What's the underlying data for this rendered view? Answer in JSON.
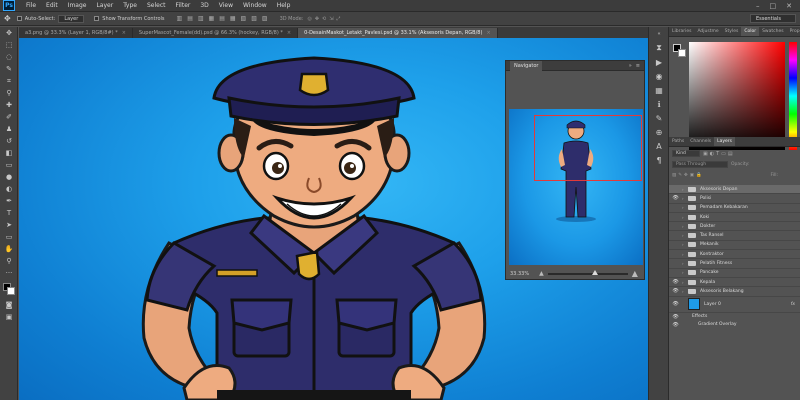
{
  "app": {
    "logo": "Ps"
  },
  "menu": [
    "File",
    "Edit",
    "Image",
    "Layer",
    "Type",
    "Select",
    "Filter",
    "3D",
    "View",
    "Window",
    "Help"
  ],
  "window_controls": [
    "–",
    "□",
    "✕"
  ],
  "options": {
    "auto_select_label": "Auto-Select:",
    "auto_select_value": "Layer",
    "transform_label": "Show Transform Controls",
    "mode_label": "3D Mode:",
    "workspace": "Essentials"
  },
  "tabs": [
    {
      "label": "a3.png @ 33.3% (Layer 1, RGB/8#) *",
      "close": "×"
    },
    {
      "label": "SuperMascot_Female(dd).psd @ 66.3% (hockey, RGB/8) *",
      "close": "×"
    },
    {
      "label": "0-DesainMaskot_Letakt_Pavlesi.psd @ 33.1% (Aksesoris Depan, RGB/8)",
      "close": "×"
    }
  ],
  "navigator": {
    "title": "Navigator",
    "zoom": "33.33%"
  },
  "color_panel": {
    "tabs": [
      "Libraries",
      "Adjustme",
      "Styles",
      "Color",
      "Swatches",
      "Properties"
    ],
    "active": "Color"
  },
  "layers_panel": {
    "tabs": [
      "Paths",
      "Channels",
      "Layers"
    ],
    "active": "Layers",
    "kind_label": "Kind",
    "blend_mode": "Pass Through",
    "opacity_label": "Opacity:",
    "fill_label": "Fill:",
    "layers": [
      {
        "name": "Aksesoris Depan",
        "visible": false,
        "selected": true
      },
      {
        "name": "Polisi",
        "visible": true,
        "selected": false
      },
      {
        "name": "Pemadam Kebakaran",
        "visible": false,
        "selected": false
      },
      {
        "name": "Koki",
        "visible": false,
        "selected": false
      },
      {
        "name": "Dokter",
        "visible": false,
        "selected": false
      },
      {
        "name": "Tas Ransel",
        "visible": false,
        "selected": false
      },
      {
        "name": "Mekanik",
        "visible": false,
        "selected": false
      },
      {
        "name": "Kontraktor",
        "visible": false,
        "selected": false
      },
      {
        "name": "Pelatih Fitness",
        "visible": false,
        "selected": false
      },
      {
        "name": "Pancake",
        "visible": false,
        "selected": false
      },
      {
        "name": "Kepala",
        "visible": true,
        "selected": false
      },
      {
        "name": "Aksesoris Belakang",
        "visible": true,
        "selected": false
      }
    ],
    "base_layer": {
      "name": "Layer 0",
      "fx": "fx",
      "effects_label": "Effects",
      "effect": "Gradient Overlay"
    }
  },
  "colors": {
    "canvas_blue": "#1ea0ea",
    "ui_dark": "#535353",
    "uniform": "#2e2d6b",
    "badge": "#e0b030"
  },
  "icons": {
    "tools": [
      "move-icon",
      "marquee-icon",
      "lasso-icon",
      "quick-select-icon",
      "crop-icon",
      "eyedropper-icon",
      "healing-icon",
      "brush-icon",
      "stamp-icon",
      "history-brush-icon",
      "eraser-icon",
      "gradient-icon",
      "blur-icon",
      "dodge-icon",
      "pen-icon",
      "type-icon",
      "path-select-icon",
      "shape-icon",
      "hand-icon",
      "zoom-icon"
    ]
  }
}
